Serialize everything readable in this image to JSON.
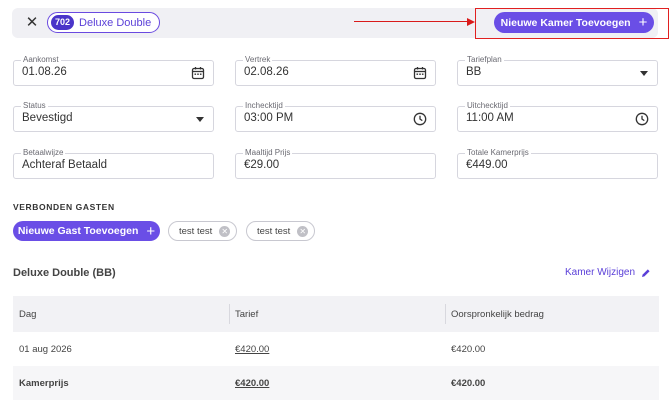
{
  "header": {
    "close_icon": "close-icon",
    "room_number": "702",
    "room_name": "Deluxe Double",
    "add_room_label": "Nieuwe Kamer Toevoegen",
    "add_icon": "plus-icon",
    "accent_color": "#6a4ee6",
    "annotation_color": "#e12020"
  },
  "form": {
    "arrival": {
      "label": "Aankomst",
      "value": "01.08.26",
      "icon": "calendar-icon"
    },
    "departure": {
      "label": "Vertrek",
      "value": "02.08.26",
      "icon": "calendar-icon"
    },
    "rate_plan": {
      "label": "Tariefplan",
      "value": "BB",
      "icon": "chevron-down-icon"
    },
    "status": {
      "label": "Status",
      "value": "Bevestigd",
      "icon": "chevron-down-icon"
    },
    "checkin": {
      "label": "Inchecktijd",
      "value": "03:00 PM",
      "icon": "clock-icon"
    },
    "checkout": {
      "label": "Uitchecktijd",
      "value": "11:00 AM",
      "icon": "clock-icon"
    },
    "payment": {
      "label": "Betaalwijze",
      "value": "Achteraf Betaald"
    },
    "meal_price": {
      "label": "Maaltijd Prijs",
      "value": "€29.00"
    },
    "total_price": {
      "label": "Totale Kamerprijs",
      "value": "€449.00"
    }
  },
  "guests": {
    "section_title": "VERBONDEN GASTEN",
    "add_label": "Nieuwe Gast Toevoegen",
    "chips": [
      {
        "name": "test test"
      },
      {
        "name": "test test"
      }
    ]
  },
  "room_section": {
    "title": "Deluxe Double (BB)",
    "change_label": "Kamer Wijzigen",
    "change_icon": "pencil-icon"
  },
  "table": {
    "headers": [
      "Dag",
      "Tarief",
      "Oorspronkelijk bedrag"
    ],
    "rows": [
      {
        "day": "01 aug 2026",
        "rate": "€420.00",
        "original": "€420.00"
      }
    ],
    "total": {
      "label": "Kamerprijs",
      "rate": "€420.00",
      "original": "€420.00"
    }
  }
}
